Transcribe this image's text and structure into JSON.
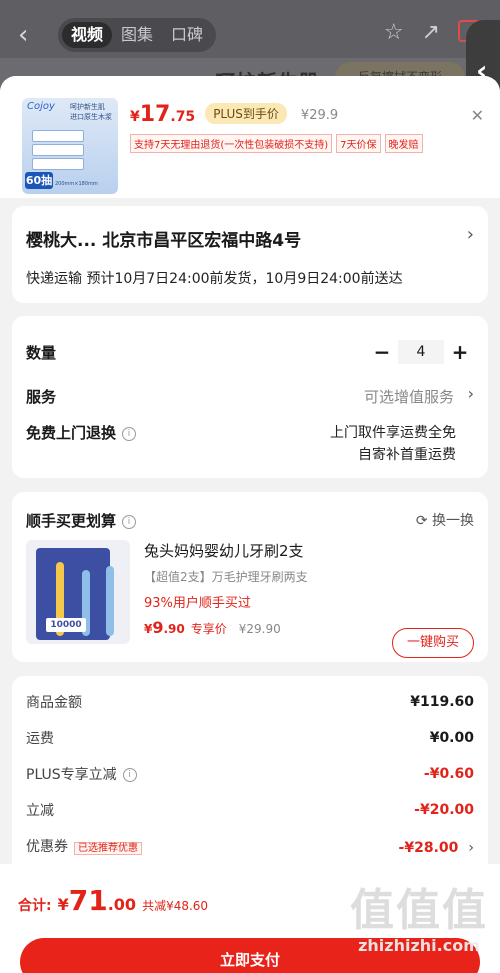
{
  "background": {
    "tabs": [
      "视频",
      "图集",
      "口碑"
    ],
    "banner_text": "呵护新生肌",
    "banner_pill": "反复擦拭不变形"
  },
  "header": {
    "product_brand": "Cojoy",
    "product_lines": [
      "呵护新生肌",
      "进口原生木浆"
    ],
    "product_count": "60抽",
    "product_footnote": "200mm×180mm",
    "price_symbol": "¥",
    "price_int": "17",
    "price_dec": ".75",
    "plus_label": "PLUS到手价",
    "original_price": "¥29.9",
    "tags": [
      "支持7天无理由退货(一次性包装破损不支持)",
      "7天价保",
      "晚发赔"
    ]
  },
  "address": {
    "text": "樱桃大...  北京市昌平区宏福中路4号",
    "shipping": "快递运输  预计10月7日24:00前发货，10月9日24:00前送达"
  },
  "options": {
    "quantity_label": "数量",
    "quantity_value": "4",
    "service_label": "服务",
    "service_value": "可选增值服务",
    "return_label": "免费上门退换",
    "return_desc_1": "上门取件享运费全免",
    "return_desc_2": "自寄补首重运费"
  },
  "recommend": {
    "title": "顺手买更划算",
    "swap_label": "换一换",
    "image_tag": "10000",
    "name": "兔头妈妈婴幼儿牙刷2支",
    "subtitle": "【超值2支】万毛护理牙刷两支",
    "percent_text": "93%用户顺手买过",
    "price_symbol": "¥",
    "price_int": "9",
    "price_dec": ".90",
    "price_label": "专享价",
    "original_price": "¥29.90",
    "buy_button": "一键购买"
  },
  "summary": {
    "rows": [
      {
        "label": "商品金额",
        "value": "¥119.60"
      },
      {
        "label": "运费",
        "value": "¥0.00"
      },
      {
        "label": "PLUS专享立减",
        "value": "-¥0.60"
      },
      {
        "label": "立减",
        "value": "-¥20.00"
      },
      {
        "label": "优惠券",
        "value": "-¥28.00"
      }
    ],
    "coupon_tag": "已选推荐优惠"
  },
  "footer": {
    "total_label": "合计:",
    "total_symbol": "¥",
    "total_int": "71",
    "total_dec": ".00",
    "saved_text": "共减¥48.60",
    "pay_button": "立即支付"
  },
  "watermark": {
    "big": "值值值",
    "small": "zhizhizhi.com"
  },
  "colors": {
    "accent_red": "#e2231a",
    "plus_gold": "#fbe8b5"
  }
}
